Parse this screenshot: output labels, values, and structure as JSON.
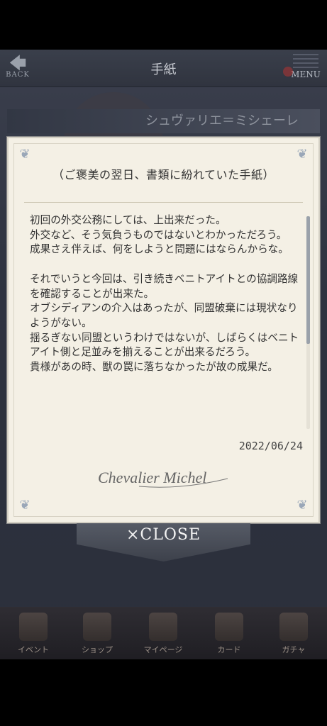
{
  "topbar": {
    "back_label": "BACK",
    "title": "手紙",
    "menu_label": "MENU"
  },
  "character_name": "シュヴァリエ＝ミシェーレ",
  "letter": {
    "heading": "（ご褒美の翌日、書類に紛れていた手紙）",
    "body": "初回の外交公務にしては、上出来だった。\n外交など、そう気負うものではないとわかっただろう。\n成果さえ伴えば、何をしようと問題にはならんからな。\n\nそれでいうと今回は、引き続きベニトアイトとの協調路線を確認することが出来た。\nオブシディアンの介入はあったが、同盟破棄には現状なりようがない。\n揺るぎない同盟というわけではないが、しばらくはベニトアイト側と足並みを揃えることが出来るだろう。\n貴様があの時、獣の罠に落ちなかったが故の成果だ。",
    "date": "2022/06/24",
    "signature": "Chevalier Michel"
  },
  "close_label": "×CLOSE",
  "bottom_nav": [
    {
      "label": "イベント",
      "icon": "event-icon"
    },
    {
      "label": "ショップ",
      "icon": "shop-icon"
    },
    {
      "label": "マイページ",
      "icon": "castle-icon"
    },
    {
      "label": "カード",
      "icon": "card-icon"
    },
    {
      "label": "ガチャ",
      "icon": "gacha-icon"
    }
  ]
}
